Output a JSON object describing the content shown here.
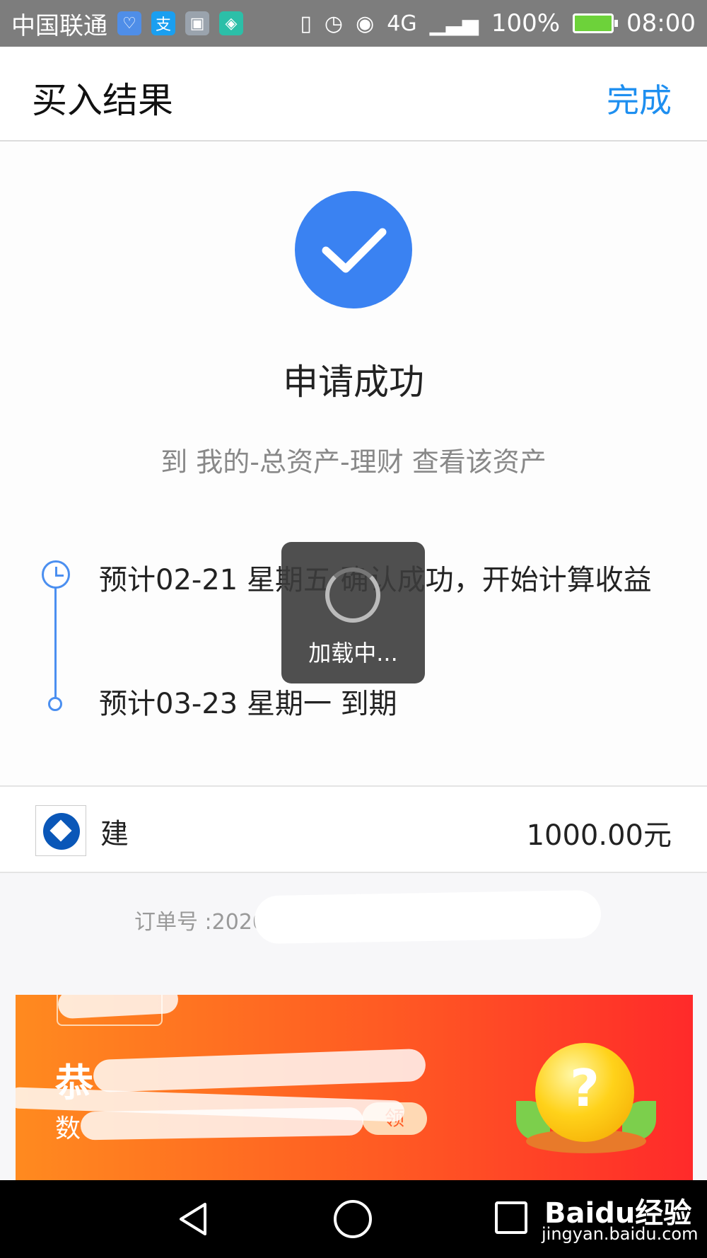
{
  "status_bar": {
    "carrier": "中国联通",
    "app_icons": [
      "health-icon",
      "alipay-icon",
      "gallery-icon",
      "shield-icon"
    ],
    "network": "4G",
    "battery": "100%",
    "time": "08:00"
  },
  "header": {
    "title": "买入结果",
    "done_label": "完成"
  },
  "result": {
    "title": "申请成功",
    "subtitle": "到 我的-总资产-理财 查看该资产"
  },
  "timeline": [
    {
      "text": "预计02-21 星期五 确认成功，开始计算收益"
    },
    {
      "text": "预计03-23 星期一 到期"
    }
  ],
  "product": {
    "name": "建",
    "amount": "1000.00元"
  },
  "order": {
    "label": "订单号 :202002201"
  },
  "loading": {
    "text": "加载中..."
  },
  "banner": {
    "title": "恭",
    "subtitle": "数",
    "claim_label": "领"
  },
  "watermark": {
    "brand": "Baidu经验",
    "url": "jingyan.baidu.com"
  },
  "colors": {
    "accent": "#1e8ff0",
    "check_circle": "#3a82f2",
    "timeline": "#4b8ff0",
    "banner_start": "#ff8a1f",
    "banner_end": "#ff2a2a"
  }
}
